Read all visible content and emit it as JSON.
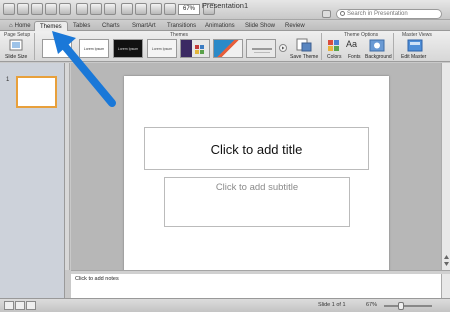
{
  "window": {
    "title": "Presentation1"
  },
  "toolbar": {
    "zoom_value": "67%",
    "search_placeholder": "Search in Presentation"
  },
  "tabs": [
    {
      "label": "Home"
    },
    {
      "label": "Themes"
    },
    {
      "label": "Tables"
    },
    {
      "label": "Charts"
    },
    {
      "label": "SmartArt"
    },
    {
      "label": "Transitions"
    },
    {
      "label": "Animations"
    },
    {
      "label": "Slide Show"
    },
    {
      "label": "Review"
    }
  ],
  "ribbon": {
    "groups": {
      "page_setup": "Page Setup",
      "themes": "Themes",
      "theme_options": "Theme Options",
      "master_views": "Master Views"
    },
    "buttons": {
      "slide_size": "Slide Size",
      "save_theme": "Save Theme",
      "colors": "Colors",
      "fonts": "Fonts",
      "background": "Background",
      "edit_master": "Edit Master"
    },
    "theme_thumbs": [
      {
        "text": "Lorem Ipsum"
      },
      {
        "text": "Lorem Ipsum"
      },
      {
        "text": "Lorem Ipsum"
      },
      {
        "text": ""
      },
      {
        "text": ""
      },
      {
        "text": ""
      }
    ],
    "fonts_icon_text": "Aa"
  },
  "slides_panel": {
    "slide_number": "1"
  },
  "slide": {
    "title_placeholder": "Click to add title",
    "subtitle_placeholder": "Click to add subtitle"
  },
  "notes": {
    "placeholder": "Click to add notes"
  },
  "statusbar": {
    "slide_position": "Slide 1 of 1",
    "zoom": "67%"
  },
  "colors": {
    "arrow": "#1a78d8",
    "slide_selection": "#e8a03b"
  }
}
